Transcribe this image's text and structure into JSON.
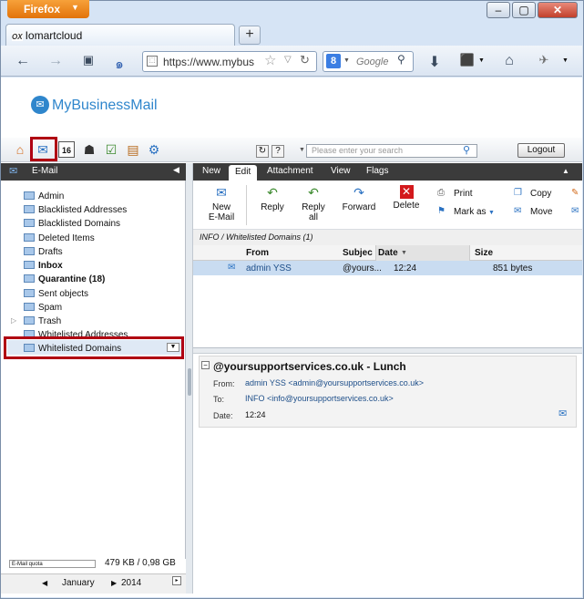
{
  "browser": {
    "menu_button": "Firefox",
    "window_controls": [
      "–",
      "▢",
      "✕"
    ],
    "tab_title": "Iomartcloud",
    "tab_favicon": "OX",
    "new_tab": "+",
    "url": "https://www.mybus",
    "search_placeholder": "Google",
    "search_engine_letter": "8"
  },
  "app": {
    "logo_text": "MyBusinessMail",
    "search_placeholder": "Please enter your search",
    "logout_label": "Logout",
    "toolbar_icons": [
      "home-icon",
      "mail-icon",
      "calendar-icon",
      "contacts-icon",
      "tasks-icon",
      "infostore-icon",
      "settings-icon"
    ]
  },
  "sidebar": {
    "header": "E-Mail",
    "folders": [
      {
        "label": "Admin",
        "bold": false
      },
      {
        "label": "Blacklisted Addresses",
        "bold": false
      },
      {
        "label": "Blacklisted Domains",
        "bold": false
      },
      {
        "label": "Deleted Items",
        "bold": false
      },
      {
        "label": "Drafts",
        "bold": false
      },
      {
        "label": "Inbox",
        "bold": true
      },
      {
        "label": "Quarantine (18)",
        "bold": true
      },
      {
        "label": "Sent objects",
        "bold": false
      },
      {
        "label": "Spam",
        "bold": false
      },
      {
        "label": "Trash",
        "bold": false
      },
      {
        "label": "Whitelisted Addresses",
        "bold": false
      },
      {
        "label": "Whitelisted Domains",
        "bold": false
      }
    ],
    "quota_label": "E-Mail quota",
    "quota_value": "479 KB / 0,98 GB",
    "calendar_month": "January",
    "calendar_year": "2014"
  },
  "tabs": [
    "New",
    "Edit",
    "Attachment",
    "View",
    "Flags"
  ],
  "ribbon": {
    "new_email": [
      "New",
      "E-Mail"
    ],
    "reply": "Reply",
    "reply_all": [
      "Reply",
      "all"
    ],
    "forward": "Forward",
    "delete": "Delete",
    "print": "Print",
    "mark_as": "Mark as",
    "copy": "Copy",
    "move": "Move"
  },
  "list": {
    "breadcrumb": "INFO / Whitelisted Domains (1)",
    "columns": [
      "From",
      "Subjec",
      "Date",
      "Size"
    ],
    "rows": [
      {
        "from": "admin YSS",
        "subject": "@yours...",
        "date": "12:24",
        "size": "851 bytes"
      }
    ]
  },
  "detail": {
    "subject": "@yoursupportservices.co.uk - Lunch",
    "from_label": "From:",
    "from_value": "admin YSS <admin@yoursupportservices.co.uk>",
    "to_label": "To:",
    "to_value": "INFO <info@yoursupportservices.co.uk>",
    "date_label": "Date:",
    "date_value": "12:24",
    "collapse": "−"
  },
  "colors": {
    "accent": "#b00012",
    "header_dark": "#3b3b3b",
    "selection": "#c9dcf1",
    "logo_blue": "#2f86cc"
  }
}
